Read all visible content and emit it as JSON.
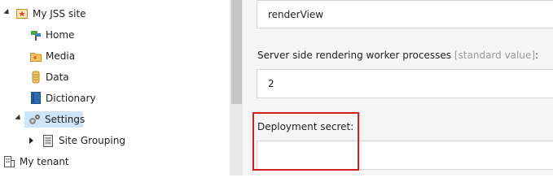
{
  "tree": {
    "items": [
      {
        "label": "My JSS site",
        "icon": "site-icon"
      },
      {
        "label": "Home",
        "icon": "home-icon"
      },
      {
        "label": "Media",
        "icon": "media-folder-icon"
      },
      {
        "label": "Data",
        "icon": "data-icon"
      },
      {
        "label": "Dictionary",
        "icon": "dictionary-icon"
      },
      {
        "label": "Settings",
        "icon": "settings-gear-icon",
        "selected": true
      },
      {
        "label": "Site Grouping",
        "icon": "site-grouping-icon"
      },
      {
        "label": "My tenant",
        "icon": "tenant-icon"
      }
    ]
  },
  "content": {
    "field1": {
      "value": "renderView"
    },
    "field2": {
      "label": "Server side rendering worker processes",
      "suffix": "[standard value]",
      "colon": ":",
      "value": "2"
    },
    "field3": {
      "label": "Deployment secret:",
      "value": ""
    }
  },
  "colors": {
    "highlight": "#d21f1f",
    "selected_bg": "#cfe4f7"
  }
}
